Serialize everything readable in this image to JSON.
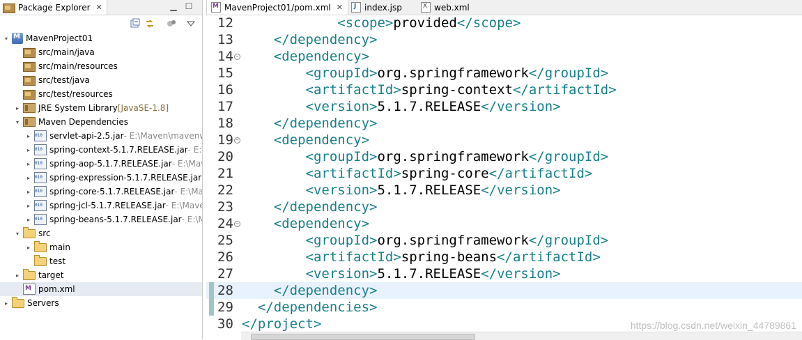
{
  "left_panel": {
    "tab_title": "Package Explorer",
    "tree": [
      {
        "id": "project",
        "label": "MavenProject01",
        "suffix": "",
        "icon": "maven-project-icon",
        "twisty": "▾",
        "indent": 0,
        "selected": false
      },
      {
        "id": "src-main-java",
        "label": "src/main/java",
        "suffix": "",
        "icon": "source-folder-icon",
        "twisty": "",
        "indent": 1,
        "selected": false
      },
      {
        "id": "src-main-resources",
        "label": "src/main/resources",
        "suffix": "",
        "icon": "source-folder-icon",
        "twisty": "",
        "indent": 1,
        "selected": false
      },
      {
        "id": "src-test-java",
        "label": "src/test/java",
        "suffix": "",
        "icon": "source-folder-icon",
        "twisty": "",
        "indent": 1,
        "selected": false
      },
      {
        "id": "src-test-resources",
        "label": "src/test/resources",
        "suffix": "",
        "icon": "source-folder-icon",
        "twisty": "",
        "indent": 1,
        "selected": false
      },
      {
        "id": "jre",
        "label": "JRE System Library",
        "suffix": " [JavaSE-1.8]",
        "icon": "library-icon",
        "twisty": "▸",
        "indent": 1,
        "selected": false
      },
      {
        "id": "maven-deps",
        "label": "Maven Dependencies",
        "suffix": "",
        "icon": "library-icon",
        "twisty": "▾",
        "indent": 1,
        "selected": false
      },
      {
        "id": "jar-servlet",
        "label": "servlet-api-2.5.jar",
        "suffix": " - E:\\Maven\\mavenw",
        "icon": "jar-icon",
        "twisty": "▸",
        "indent": 2,
        "selected": false
      },
      {
        "id": "jar-context",
        "label": "spring-context-5.1.7.RELEASE.jar",
        "suffix": " - E:\\M",
        "icon": "jar-icon",
        "twisty": "▸",
        "indent": 2,
        "selected": false
      },
      {
        "id": "jar-aop",
        "label": "spring-aop-5.1.7.RELEASE.jar",
        "suffix": " - E:\\Mav",
        "icon": "jar-icon",
        "twisty": "▸",
        "indent": 2,
        "selected": false
      },
      {
        "id": "jar-expression",
        "label": "spring-expression-5.1.7.RELEASE.jar",
        "suffix": " -",
        "icon": "jar-icon",
        "twisty": "▸",
        "indent": 2,
        "selected": false
      },
      {
        "id": "jar-core",
        "label": "spring-core-5.1.7.RELEASE.jar",
        "suffix": " - E:\\Mav",
        "icon": "jar-icon",
        "twisty": "▸",
        "indent": 2,
        "selected": false
      },
      {
        "id": "jar-jcl",
        "label": "spring-jcl-5.1.7.RELEASE.jar",
        "suffix": " - E:\\Maver",
        "icon": "jar-icon",
        "twisty": "▸",
        "indent": 2,
        "selected": false
      },
      {
        "id": "jar-beans",
        "label": "spring-beans-5.1.7.RELEASE.jar",
        "suffix": " - E:\\M",
        "icon": "jar-icon",
        "twisty": "▸",
        "indent": 2,
        "selected": false
      },
      {
        "id": "src",
        "label": "src",
        "suffix": "",
        "icon": "folder-icon",
        "twisty": "▾",
        "indent": 1,
        "selected": false
      },
      {
        "id": "main",
        "label": "main",
        "suffix": "",
        "icon": "folder-icon",
        "twisty": "▸",
        "indent": 2,
        "selected": false
      },
      {
        "id": "test",
        "label": "test",
        "suffix": "",
        "icon": "folder-icon",
        "twisty": "",
        "indent": 2,
        "selected": false
      },
      {
        "id": "target",
        "label": "target",
        "suffix": "",
        "icon": "folder-icon",
        "twisty": "▸",
        "indent": 1,
        "selected": false
      },
      {
        "id": "pom",
        "label": "pom.xml",
        "suffix": "",
        "icon": "maven-xml-icon",
        "twisty": "",
        "indent": 1,
        "selected": true
      },
      {
        "id": "servers",
        "label": "Servers",
        "suffix": "",
        "icon": "folder-icon",
        "twisty": "▸",
        "indent": 0,
        "selected": false
      }
    ]
  },
  "editor": {
    "tabs": [
      {
        "label": "MavenProject01/pom.xml",
        "active": true,
        "icon": "maven-xml-icon",
        "closable": true
      },
      {
        "label": "index.jsp",
        "active": false,
        "icon": "jsp-file-icon",
        "closable": false
      },
      {
        "label": "web.xml",
        "active": false,
        "icon": "xml-file-icon",
        "closable": false
      }
    ],
    "lines": [
      {
        "n": "12",
        "fold": false,
        "indent": "            ",
        "parts": [
          [
            "tag",
            "<scope>"
          ],
          [
            "txt",
            "provided"
          ],
          [
            "tag",
            "</scope>"
          ]
        ]
      },
      {
        "n": "13",
        "fold": false,
        "indent": "    ",
        "parts": [
          [
            "tag",
            "</dependency>"
          ]
        ]
      },
      {
        "n": "14",
        "fold": true,
        "indent": "    ",
        "parts": [
          [
            "tag",
            "<dependency>"
          ]
        ]
      },
      {
        "n": "15",
        "fold": false,
        "indent": "        ",
        "parts": [
          [
            "tag",
            "<groupId>"
          ],
          [
            "txt",
            "org.springframework"
          ],
          [
            "tag",
            "</groupId>"
          ]
        ]
      },
      {
        "n": "16",
        "fold": false,
        "indent": "        ",
        "parts": [
          [
            "tag",
            "<artifactId>"
          ],
          [
            "txt",
            "spring-context"
          ],
          [
            "tag",
            "</artifactId>"
          ]
        ]
      },
      {
        "n": "17",
        "fold": false,
        "indent": "        ",
        "parts": [
          [
            "tag",
            "<version>"
          ],
          [
            "txt",
            "5.1.7.RELEASE"
          ],
          [
            "tag",
            "</version>"
          ]
        ]
      },
      {
        "n": "18",
        "fold": false,
        "indent": "    ",
        "parts": [
          [
            "tag",
            "</dependency>"
          ]
        ]
      },
      {
        "n": "19",
        "fold": true,
        "indent": "    ",
        "parts": [
          [
            "tag",
            "<dependency>"
          ]
        ]
      },
      {
        "n": "20",
        "fold": false,
        "indent": "        ",
        "parts": [
          [
            "tag",
            "<groupId>"
          ],
          [
            "txt",
            "org.springframework"
          ],
          [
            "tag",
            "</groupId>"
          ]
        ]
      },
      {
        "n": "21",
        "fold": false,
        "indent": "        ",
        "parts": [
          [
            "tag",
            "<artifactId>"
          ],
          [
            "txt",
            "spring-core"
          ],
          [
            "tag",
            "</artifactId>"
          ]
        ]
      },
      {
        "n": "22",
        "fold": false,
        "indent": "        ",
        "parts": [
          [
            "tag",
            "<version>"
          ],
          [
            "txt",
            "5.1.7.RELEASE"
          ],
          [
            "tag",
            "</version>"
          ]
        ]
      },
      {
        "n": "23",
        "fold": false,
        "indent": "    ",
        "parts": [
          [
            "tag",
            "</dependency>"
          ]
        ]
      },
      {
        "n": "24",
        "fold": true,
        "indent": "    ",
        "parts": [
          [
            "tag",
            "<dependency>"
          ]
        ]
      },
      {
        "n": "25",
        "fold": false,
        "indent": "        ",
        "parts": [
          [
            "tag",
            "<groupId>"
          ],
          [
            "txt",
            "org.springframework"
          ],
          [
            "tag",
            "</groupId>"
          ]
        ]
      },
      {
        "n": "26",
        "fold": false,
        "indent": "        ",
        "parts": [
          [
            "tag",
            "<artifactId>"
          ],
          [
            "txt",
            "spring-beans"
          ],
          [
            "tag",
            "</artifactId>"
          ]
        ]
      },
      {
        "n": "27",
        "fold": false,
        "indent": "        ",
        "parts": [
          [
            "tag",
            "<version>"
          ],
          [
            "txt",
            "5.1.7.RELEASE"
          ],
          [
            "tag",
            "</version>"
          ]
        ]
      },
      {
        "n": "28",
        "fold": false,
        "indent": "    ",
        "parts": [
          [
            "tag",
            "</dependency>"
          ]
        ],
        "current": true
      },
      {
        "n": "29",
        "fold": false,
        "indent": "  ",
        "parts": [
          [
            "tag",
            "</dependencies>"
          ]
        ]
      },
      {
        "n": "30",
        "fold": false,
        "indent": "",
        "parts": [
          [
            "tag",
            "</project>"
          ]
        ]
      }
    ]
  },
  "watermark": "https://blog.csdn.net/weixin_44789861",
  "colors": {
    "tag": "#17808a",
    "text": "#000000",
    "current_line": "#e8f2fe",
    "selection": "#e6eaf2"
  }
}
